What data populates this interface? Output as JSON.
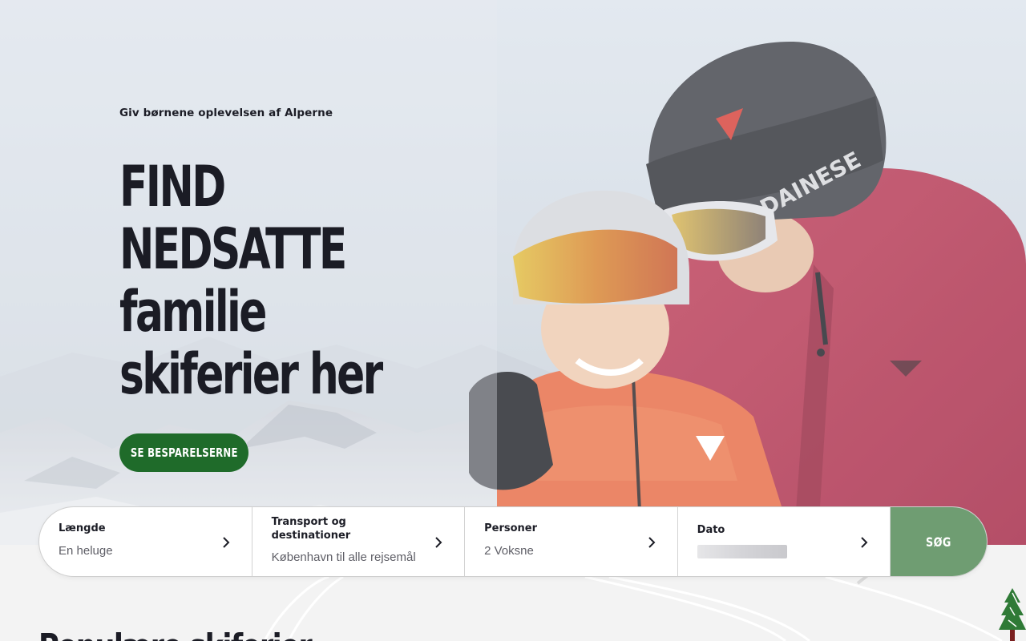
{
  "hero": {
    "eyebrow": "Giv børnene oplevelsen af Alperne",
    "headline_lines": [
      "FIND",
      "NEDSATTE",
      "familie",
      "skiferier her"
    ],
    "cta_label": "SE BESPARELSERNE"
  },
  "search": {
    "fields": [
      {
        "label": "Længde",
        "value": "En heluge"
      },
      {
        "label": "Transport og destinationer",
        "value": "København til alle rejsemål"
      },
      {
        "label": "Personer",
        "value": "2 Voksne"
      },
      {
        "label": "Dato",
        "value": ""
      }
    ],
    "button_label": "SØG"
  },
  "section": {
    "heading": "Populære skiferier"
  },
  "colors": {
    "cta_green": "#1f6b2a",
    "search_button": "#6f9d72",
    "headline_text": "#1b1c25"
  },
  "icons": {
    "field_chevron": "chevron-right-icon",
    "tree": "pine-tree-icon"
  }
}
